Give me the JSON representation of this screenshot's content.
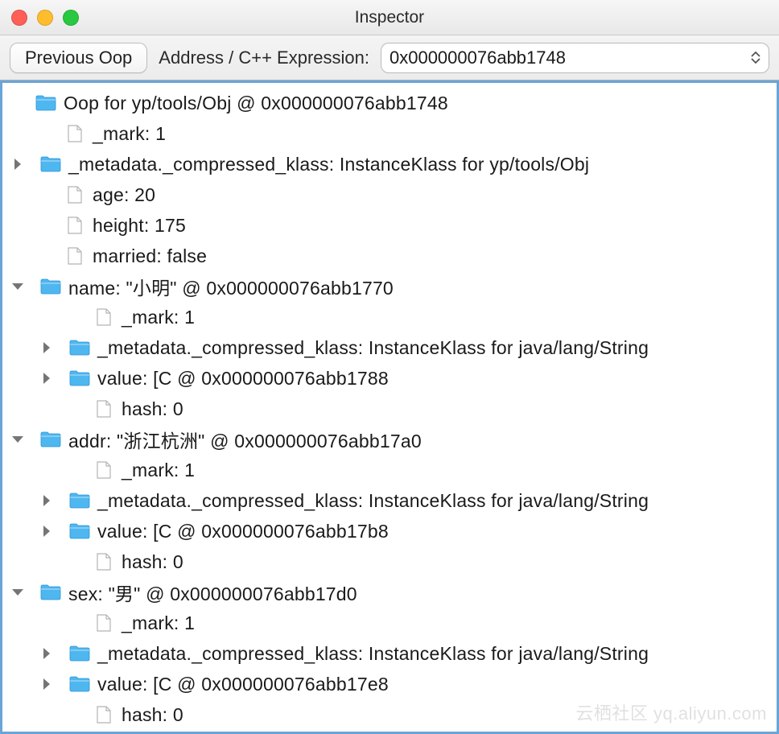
{
  "window": {
    "title": "Inspector"
  },
  "toolbar": {
    "prev_label": "Previous Oop",
    "address_label": "Address / C++ Expression:",
    "address_value": "0x000000076abb1748"
  },
  "tree": {
    "root": {
      "label": "Oop for yp/tools/Obj @ 0x000000076abb1748"
    },
    "root_mark": {
      "label": "_mark: 1"
    },
    "root_meta": {
      "label": "_metadata._compressed_klass: InstanceKlass for yp/tools/Obj"
    },
    "age": {
      "label": "age: 20"
    },
    "height": {
      "label": "height: 175"
    },
    "married": {
      "label": "married: false"
    },
    "name": {
      "label": "name: \"小明\" @ 0x000000076abb1770"
    },
    "name_mark": {
      "label": "_mark: 1"
    },
    "name_meta": {
      "label": "_metadata._compressed_klass: InstanceKlass for java/lang/String"
    },
    "name_value": {
      "label": "value: [C @ 0x000000076abb1788"
    },
    "name_hash": {
      "label": "hash: 0"
    },
    "addr": {
      "label": "addr: \"浙江杭洲\" @ 0x000000076abb17a0"
    },
    "addr_mark": {
      "label": "_mark: 1"
    },
    "addr_meta": {
      "label": "_metadata._compressed_klass: InstanceKlass for java/lang/String"
    },
    "addr_value": {
      "label": "value: [C @ 0x000000076abb17b8"
    },
    "addr_hash": {
      "label": "hash: 0"
    },
    "sex": {
      "label": "sex: \"男\" @ 0x000000076abb17d0"
    },
    "sex_mark": {
      "label": "_mark: 1"
    },
    "sex_meta": {
      "label": "_metadata._compressed_klass: InstanceKlass for java/lang/String"
    },
    "sex_value": {
      "label": "value: [C @ 0x000000076abb17e8"
    },
    "sex_hash": {
      "label": "hash: 0"
    }
  },
  "watermark": "云栖社区 yq.aliyun.com"
}
